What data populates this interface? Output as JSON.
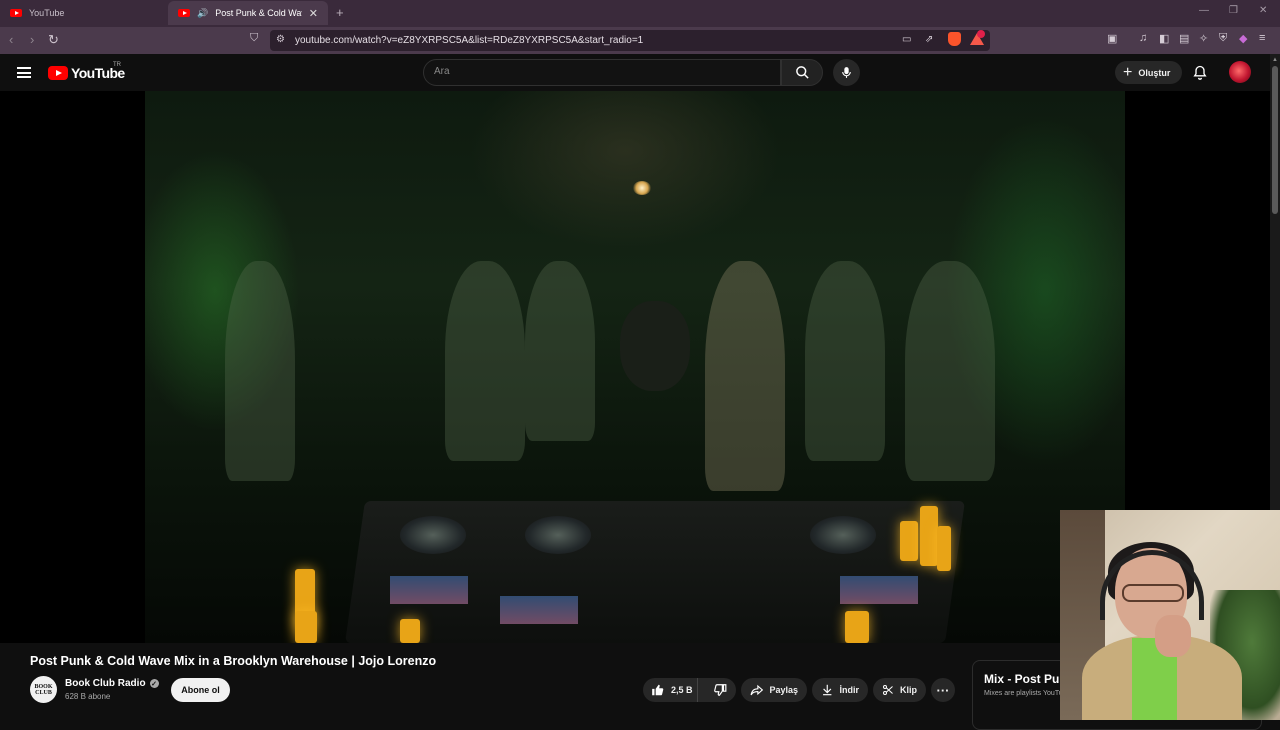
{
  "browser": {
    "tabs": [
      {
        "title": "YouTube",
        "active": false
      },
      {
        "title": "Post Punk & Cold Wave Mix in a Brooklyn Warehouse | Jojo Lorenzo - YouTube",
        "active": true
      }
    ],
    "url": "youtube.com/watch?v=eZ8YXRPSC5A&list=RDeZ8YXRPSC5A&start_radio=1"
  },
  "header": {
    "logo_text": "YouTube",
    "country_code": "TR",
    "search_placeholder": "Ara",
    "create_label": "Oluştur"
  },
  "video": {
    "title": "Post Punk & Cold Wave Mix in a Brooklyn Warehouse | Jojo Lorenzo"
  },
  "channel": {
    "name": "Book Club Radio",
    "avatar_text": "BOOK CLUB",
    "subscribers": "628 B abone",
    "subscribe_label": "Abone ol"
  },
  "actions": {
    "likes": "2,5 B",
    "share_label": "Paylaş",
    "download_label": "İndir",
    "clip_label": "Klip",
    "more_label": "···"
  },
  "mix": {
    "title": "Mix - Post Punk & Cold Wave",
    "subtitle": "Mixes are playlists YouTube makes for you"
  },
  "colors": {
    "accent": "#ff0000",
    "page_bg": "#0f0f0f",
    "tab_bar": "#3a2a3b",
    "address_bar": "#4b3a4c",
    "pill_bg": "#272727"
  },
  "icons": [
    "youtube-favicon",
    "speaker-icon",
    "close-icon",
    "plus-icon",
    "back-icon",
    "forward-icon",
    "reload-icon",
    "bookmark-icon",
    "site-settings-icon",
    "brave-shields-icon",
    "brave-rewards-icon",
    "menu-icon",
    "search-icon",
    "mic-icon",
    "bell-icon",
    "like-icon",
    "dislike-icon",
    "share-icon",
    "download-icon",
    "scissors-icon",
    "more-icon",
    "verified-icon"
  ]
}
